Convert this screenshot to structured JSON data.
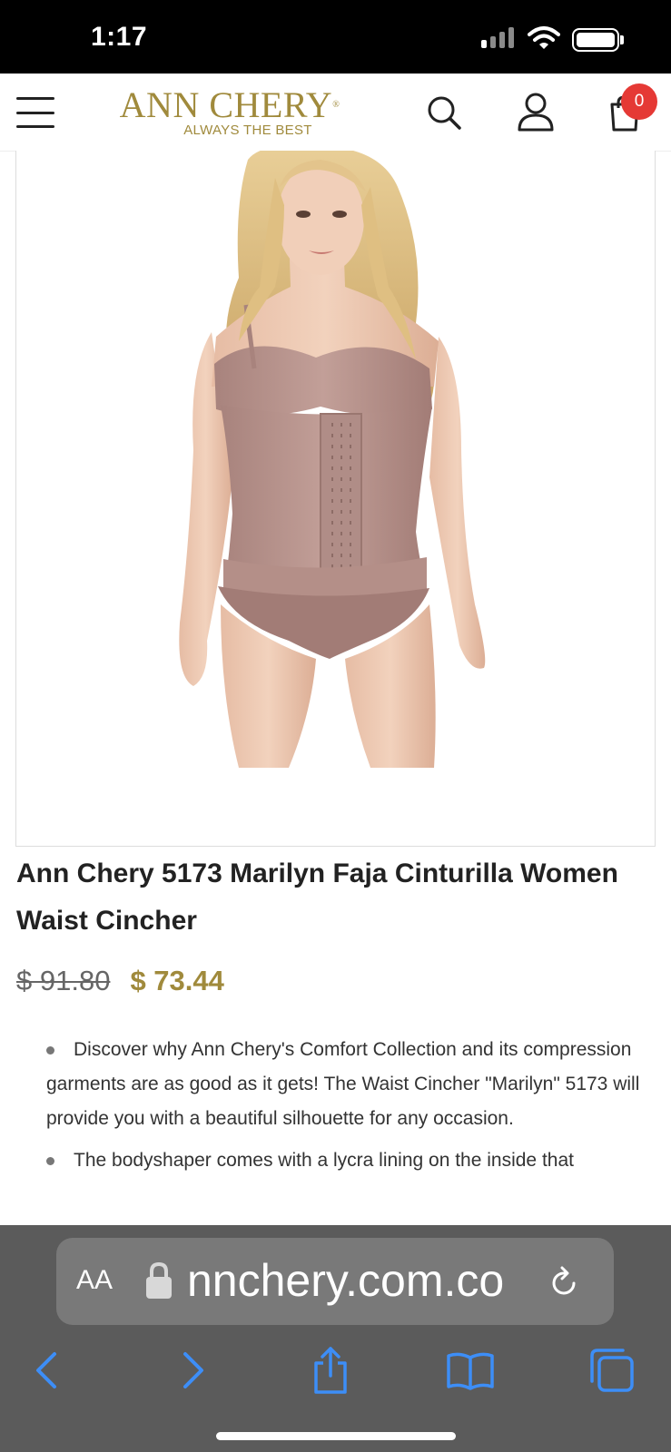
{
  "status_bar": {
    "time": "1:17"
  },
  "header": {
    "brand_name": "ANN CHERY",
    "brand_tagline": "ALWAYS THE BEST",
    "cart_count": "0"
  },
  "product": {
    "title": "Ann Chery 5173 Marilyn Faja Cinturilla Women Waist Cincher",
    "price_original": "$ 91.80",
    "price_sale": "$ 73.44",
    "description": [
      "Discover why Ann Chery's Comfort Collection and its compression garments are as good as it gets! The Waist Cincher \"Marilyn\" 5173 will provide you with a beautiful silhouette for any occasion.",
      "The bodyshaper comes with a lycra lining on the inside that"
    ]
  },
  "browser": {
    "text_size_label": "AA",
    "url": "nnchery.com.co"
  },
  "colors": {
    "brand_gold": "#a08a3c",
    "badge_red": "#e53935",
    "browser_blue": "#3d8ef7"
  },
  "icons": [
    "menu-icon",
    "search-icon",
    "account-icon",
    "cart-icon",
    "lock-icon",
    "reload-icon",
    "back-icon",
    "forward-icon",
    "share-icon",
    "bookmarks-icon",
    "tabs-icon"
  ]
}
